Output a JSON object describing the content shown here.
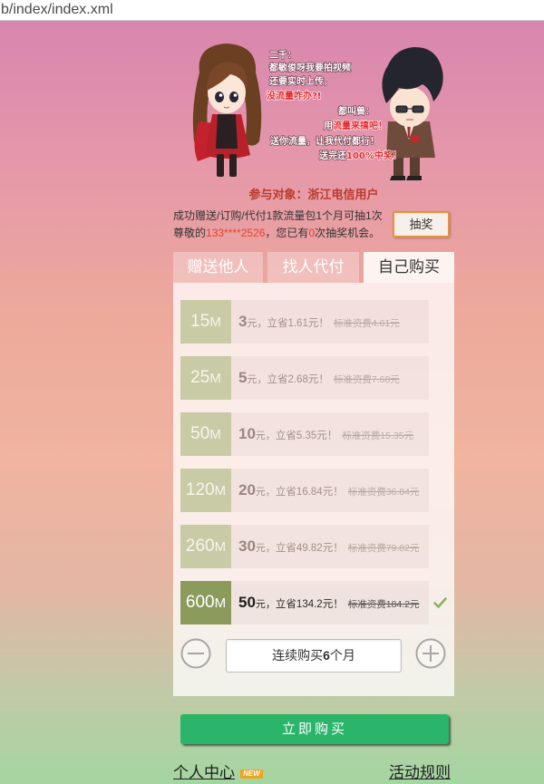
{
  "browser": {
    "url": "b/index/index.xml"
  },
  "illustration": {
    "girl_speaker": "二千：",
    "girl_line1": "都敏俊呀我要拍视频",
    "girl_line2": "还要实时上传，",
    "girl_line3": "没流量咋办?!",
    "guy_speaker": "都叫兽：",
    "guy_line1_prefix": "用",
    "guy_line1_highlight": "流量来搞吧！",
    "guy_line2": "送你流量，让我代付都行！",
    "guy_line3_prefix": "送完还",
    "guy_line3_highlight": "100%中奖！"
  },
  "promo": {
    "target": "参与对象：浙江电信用户",
    "rule": "成功赠送/订购/代付1款流量包1个月可抽1次",
    "greeting_prefix": "尊敬的",
    "phone": "133****2526",
    "greeting_mid": "，您已有",
    "chances": "0",
    "greeting_suffix": "次抽奖机会。",
    "lottery_button": "抽奖"
  },
  "tabs": [
    {
      "label": "赠送他人",
      "active": false
    },
    {
      "label": "找人代付",
      "active": false
    },
    {
      "label": "自己购买",
      "active": true
    }
  ],
  "packages": [
    {
      "size": "15",
      "unit": "M",
      "price": "3",
      "price_unit": "元，",
      "saving": "立省1.61元！",
      "standard": "标准资费4.61元",
      "selected": false
    },
    {
      "size": "25",
      "unit": "M",
      "price": "5",
      "price_unit": "元，",
      "saving": "立省2.68元！",
      "standard": "标准资费7.68元",
      "selected": false
    },
    {
      "size": "50",
      "unit": "M",
      "price": "10",
      "price_unit": "元，",
      "saving": "立省5.35元！",
      "standard": "标准资费15.35元",
      "selected": false
    },
    {
      "size": "120",
      "unit": "M",
      "price": "20",
      "price_unit": "元，",
      "saving": "立省16.84元！",
      "standard": "标准资费36.84元",
      "selected": false
    },
    {
      "size": "260",
      "unit": "M",
      "price": "30",
      "price_unit": "元，",
      "saving": "立省49.82元！",
      "standard": "标准资费79.82元",
      "selected": false
    },
    {
      "size": "600",
      "unit": "M",
      "price": "50",
      "price_unit": "元，",
      "saving": "立省134.2元！",
      "standard": "标准资费184.2元",
      "selected": true
    }
  ],
  "duration": {
    "prefix": "连续购买",
    "months": "6",
    "suffix": "个月"
  },
  "buy_button": "立即购买",
  "footer": {
    "personal_center": "个人中心",
    "new_badge": "NEW",
    "activity_rules": "活动规则"
  },
  "icons": {
    "selected_mark": "check-icon",
    "decrease": "minus-circle-icon",
    "increase": "plus-circle-icon"
  },
  "colors": {
    "target_red": "#b93b2c",
    "accent_red": "#e8402a",
    "lottery_border": "#e8913b",
    "size_box": "#c9caa6",
    "size_box_selected": "#8b9b5c",
    "check": "#8ab35f",
    "buy_button": "#2bb56b",
    "new_badge": "#f0a31c"
  }
}
